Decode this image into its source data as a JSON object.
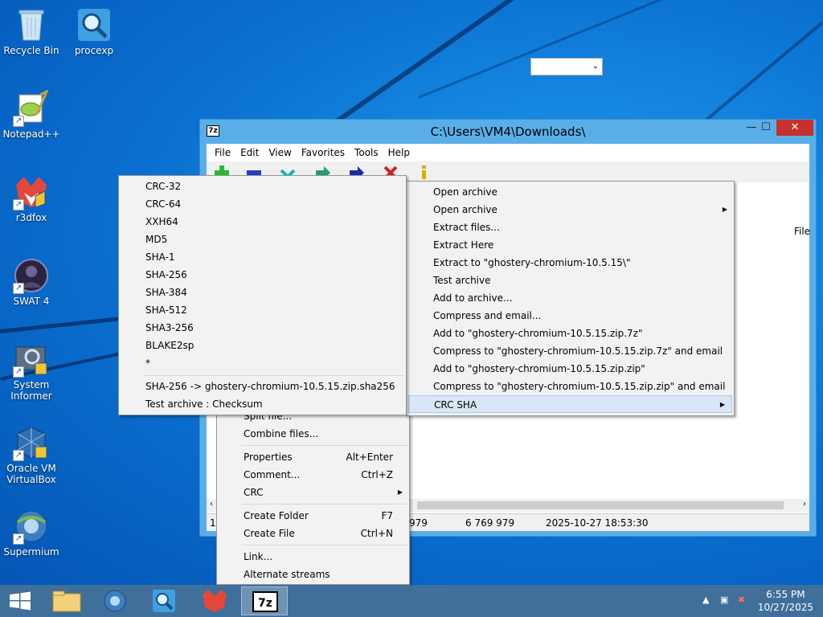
{
  "desktop": {
    "icons": [
      {
        "label": "Recycle Bin"
      },
      {
        "label": "procexp"
      },
      {
        "label": "Notepad++"
      },
      {
        "label": "r3dfox"
      },
      {
        "label": "SWAT 4"
      },
      {
        "label": "System Informer"
      },
      {
        "label": "Oracle VM VirtualBox"
      },
      {
        "label": "Supermium"
      }
    ]
  },
  "window": {
    "title": "C:\\Users\\VM4\\Downloads\\",
    "app_icon": "7z",
    "controls": {
      "minimize": "—",
      "maximize": "☐",
      "close": "✕"
    },
    "menubar": [
      "File",
      "Edit",
      "View",
      "Favorites",
      "Tools",
      "Help"
    ],
    "column_header": "File",
    "status": [
      "1",
      "979",
      "6 769 979",
      "2025-10-27 18:53:30"
    ]
  },
  "context_menu": {
    "items": [
      {
        "label": "Open archive"
      },
      {
        "label": "Open archive"
      },
      {
        "label": "Extract files..."
      },
      {
        "label": "Extract Here"
      },
      {
        "label": "Extract to \"ghostery-chromium-10.5.15\\\""
      },
      {
        "label": "Test archive"
      },
      {
        "label": "Add to archive..."
      },
      {
        "label": "Compress and email..."
      },
      {
        "label": "Add to \"ghostery-chromium-10.5.15.zip.7z\""
      },
      {
        "label": "Compress to \"ghostery-chromium-10.5.15.zip.7z\" and email"
      },
      {
        "label": "Add to \"ghostery-chromium-10.5.15.zip.zip\""
      },
      {
        "label": "Compress to \"ghostery-chromium-10.5.15.zip.zip\" and email"
      },
      {
        "label": "CRC SHA"
      }
    ]
  },
  "crc_submenu": {
    "items": [
      {
        "label": "CRC-32"
      },
      {
        "label": "CRC-64"
      },
      {
        "label": "XXH64"
      },
      {
        "label": "MD5"
      },
      {
        "label": "SHA-1"
      },
      {
        "label": "SHA-256"
      },
      {
        "label": "SHA-384"
      },
      {
        "label": "SHA-512"
      },
      {
        "label": "SHA3-256"
      },
      {
        "label": "BLAKE2sp"
      },
      {
        "label": "*"
      },
      {
        "label": "SHA-256 -> ghostery-chromium-10.5.15.zip.sha256"
      },
      {
        "label": "Test archive : Checksum"
      }
    ]
  },
  "file_menu": {
    "items": [
      {
        "label": "Split file..."
      },
      {
        "label": "Combine files..."
      },
      {
        "label": "Properties",
        "accel": "Alt+Enter"
      },
      {
        "label": "Comment...",
        "accel": "Ctrl+Z"
      },
      {
        "label": "CRC"
      },
      {
        "label": "Create Folder",
        "accel": "F7"
      },
      {
        "label": "Create File",
        "accel": "Ctrl+N"
      },
      {
        "label": "Link..."
      },
      {
        "label": "Alternate streams"
      }
    ]
  },
  "taskbar": {
    "time": "6:55 PM",
    "date": "10/27/2025"
  },
  "colors": {
    "desktop": "#0a6fd0",
    "window_frame": "#5aaee8",
    "close_button": "#c7312b",
    "taskbar": "#3f6f9a",
    "highlight": "#d8e6f5"
  }
}
